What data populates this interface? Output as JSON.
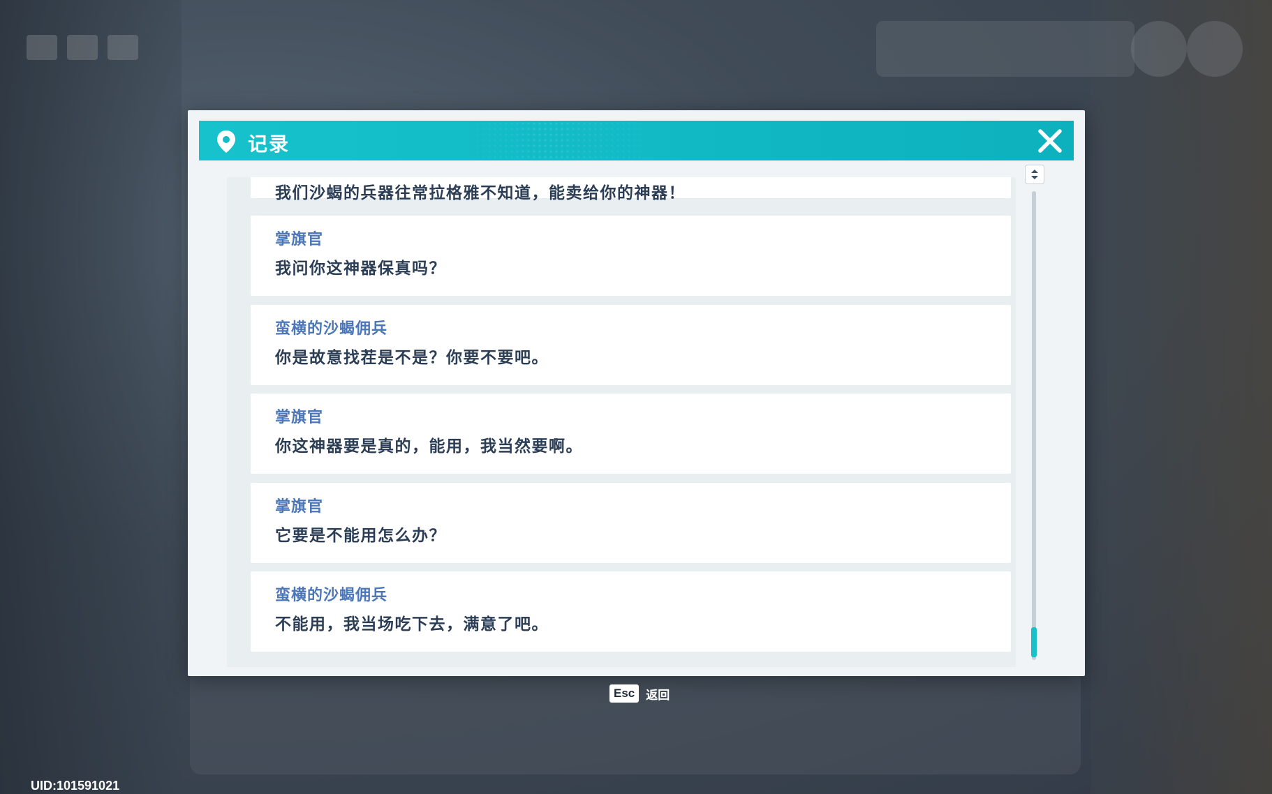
{
  "dialog": {
    "title": "记录",
    "icon": "location-pin-icon",
    "close_icon": "close-icon"
  },
  "log": {
    "partial_top_line": "我们沙蝎的兵器往常拉格雅不知道，能卖给你的神器！",
    "entries": [
      {
        "speaker": "掌旗官",
        "line": "我问你这神器保真吗？"
      },
      {
        "speaker": "蛮横的沙蝎佣兵",
        "line": "你是故意找茬是不是？你要不要吧。"
      },
      {
        "speaker": "掌旗官",
        "line": "你这神器要是真的，能用，我当然要啊。"
      },
      {
        "speaker": "掌旗官",
        "line": "它要是不能用怎么办？"
      },
      {
        "speaker": "蛮横的沙蝎佣兵",
        "line": "不能用，我当场吃下去，满意了吧。"
      }
    ]
  },
  "scrollbar": {
    "position_fraction": 1.0,
    "button_icon": "sort-arrows-icon"
  },
  "footer": {
    "esc_key": "Esc",
    "esc_label": "返回"
  },
  "uid": "UID:101591021",
  "colors": {
    "header": "#12bcc7",
    "speaker": "#4b77b9",
    "text": "#2c3e56",
    "scroll_thumb": "#17c0ca"
  }
}
